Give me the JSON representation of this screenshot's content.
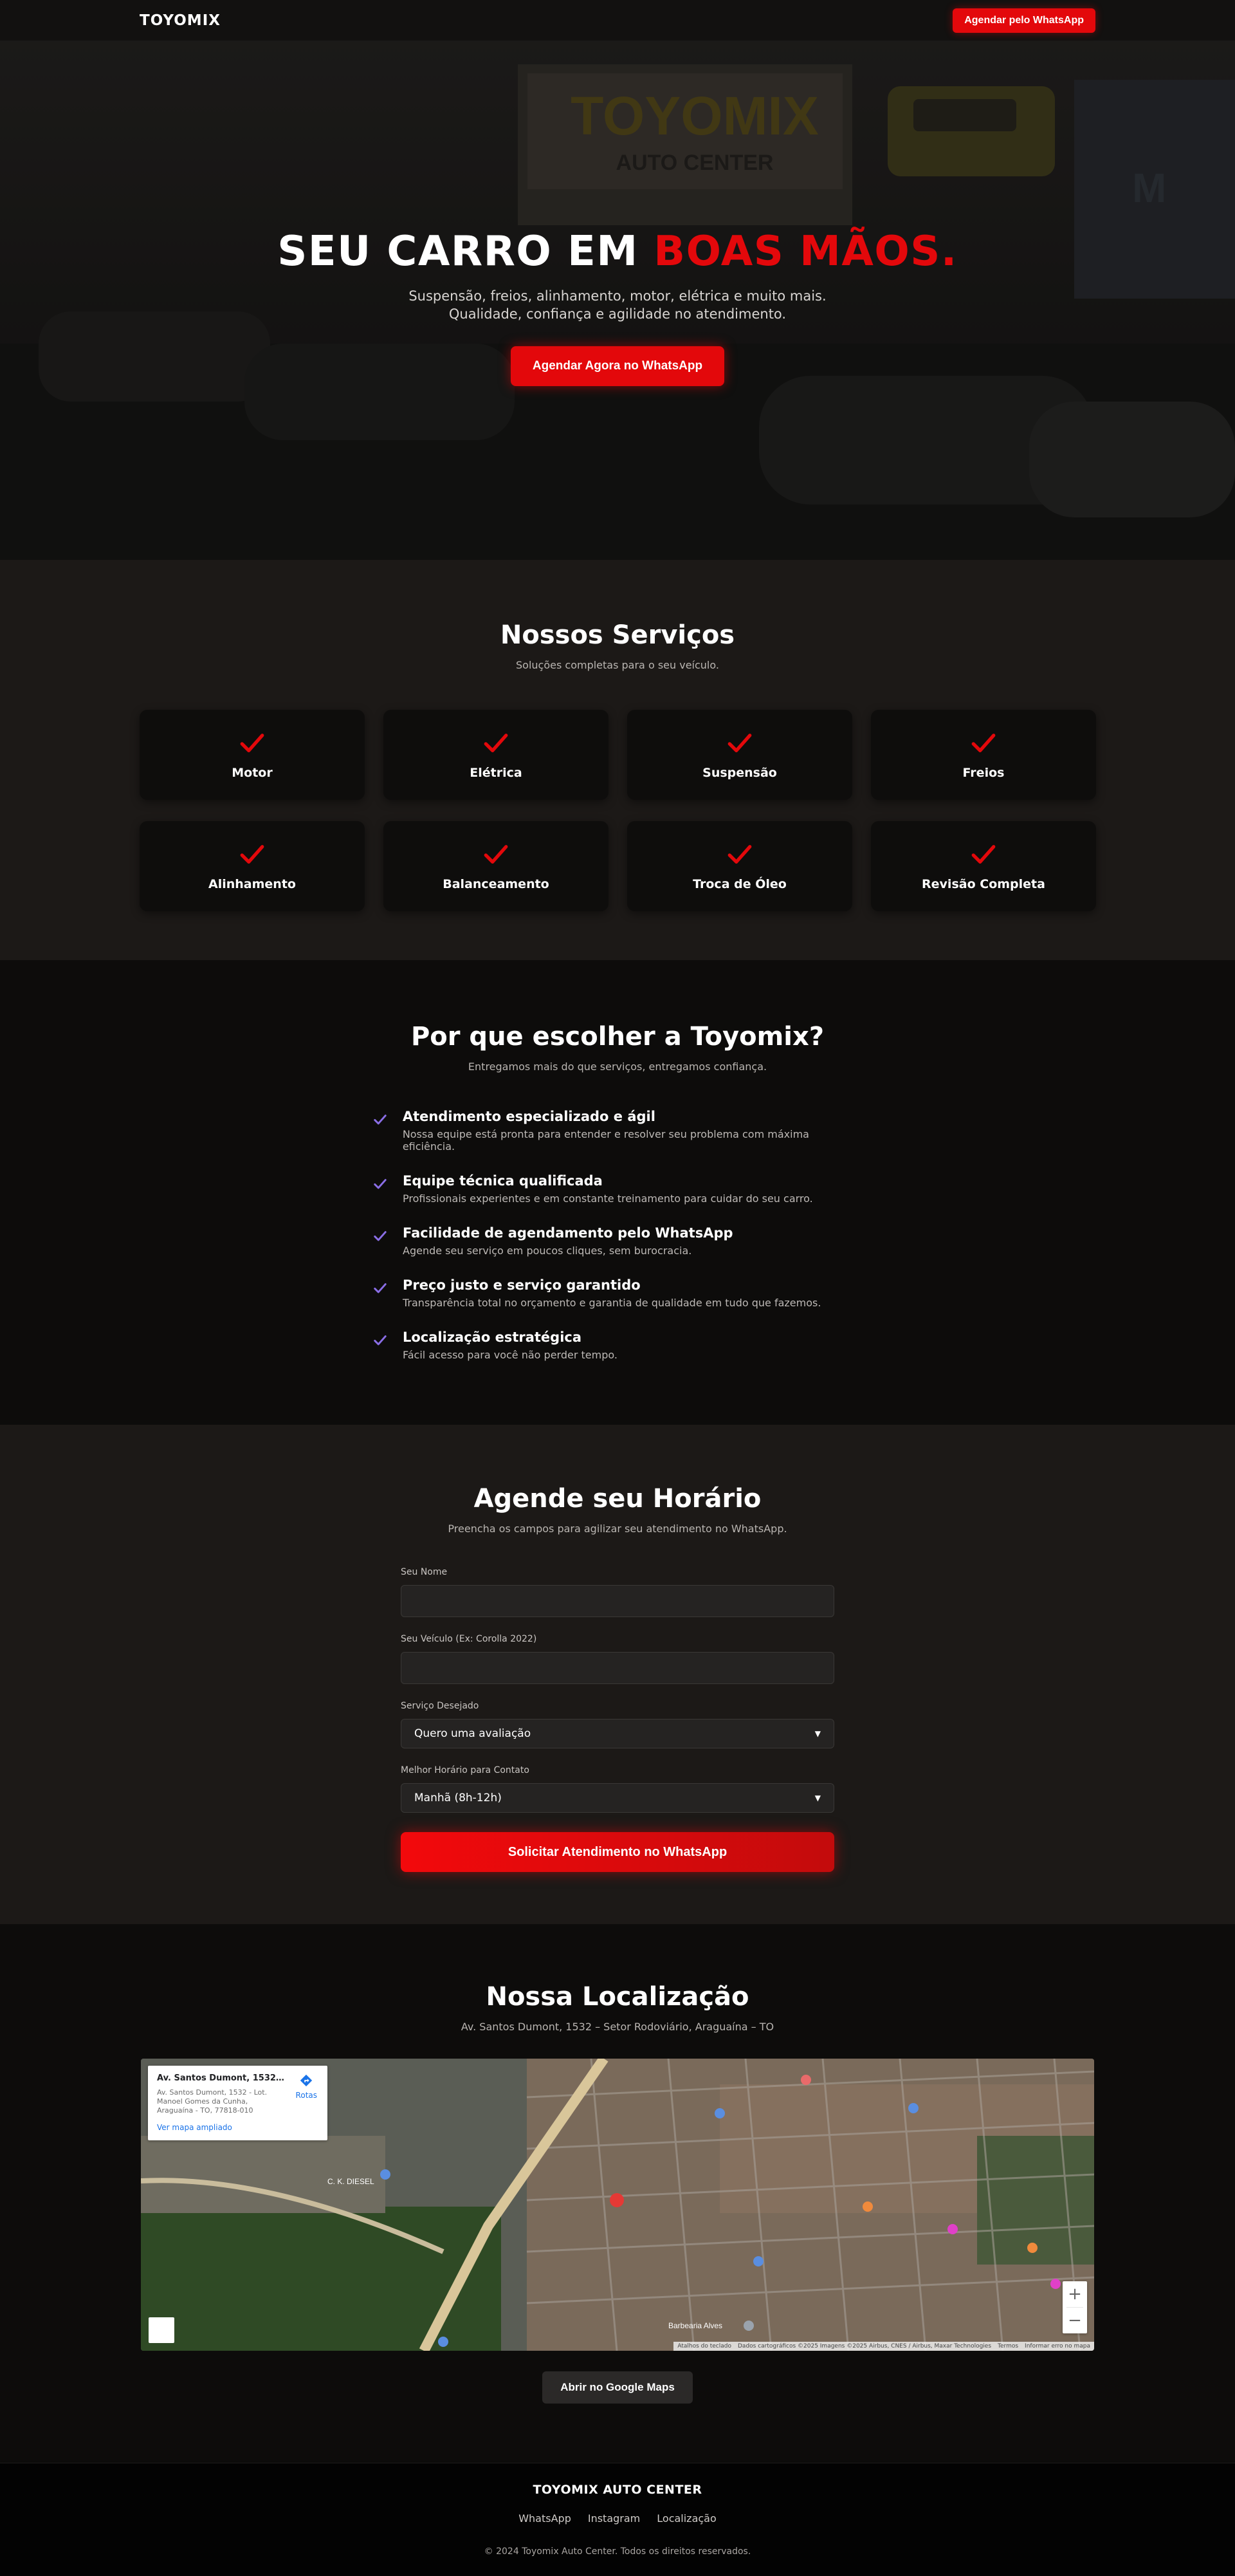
{
  "colors": {
    "accent": "#e3080b",
    "check_purple": "#8a6ee6",
    "background": "#0d0c0b",
    "section_alt": "#1c1917"
  },
  "nav": {
    "logo": "TOYOMIX",
    "cta": "Agendar pelo WhatsApp"
  },
  "hero": {
    "title_main": "SEU CARRO EM",
    "title_accent": "BOAS MÃOS.",
    "subtitle": "Suspensão, freios, alinhamento, motor, elétrica e muito mais. Qualidade, confiança e agilidade no atendimento.",
    "cta": "Agendar Agora no WhatsApp",
    "bg_sign_1": "TOYOMIX",
    "bg_sign_2": "AUTO CENTER"
  },
  "services": {
    "title": "Nossos Serviços",
    "subtitle": "Soluções completas para o seu veículo.",
    "items": [
      {
        "label": "Motor",
        "icon": "check-icon"
      },
      {
        "label": "Elétrica",
        "icon": "check-icon"
      },
      {
        "label": "Suspensão",
        "icon": "check-icon"
      },
      {
        "label": "Freios",
        "icon": "check-icon"
      },
      {
        "label": "Alinhamento",
        "icon": "check-icon"
      },
      {
        "label": "Balanceamento",
        "icon": "check-icon"
      },
      {
        "label": "Troca de Óleo",
        "icon": "check-icon"
      },
      {
        "label": "Revisão Completa",
        "icon": "check-icon"
      }
    ]
  },
  "why": {
    "title": "Por que escolher a Toyomix?",
    "subtitle": "Entregamos mais do que serviços, entregamos confiança.",
    "items": [
      {
        "title": "Atendimento especializado e ágil",
        "desc": "Nossa equipe está pronta para entender e resolver seu problema com máxima eficiência."
      },
      {
        "title": "Equipe técnica qualificada",
        "desc": "Profissionais experientes e em constante treinamento para cuidar do seu carro."
      },
      {
        "title": "Facilidade de agendamento pelo WhatsApp",
        "desc": "Agende seu serviço em poucos cliques, sem burocracia."
      },
      {
        "title": "Preço justo e serviço garantido",
        "desc": "Transparência total no orçamento e garantia de qualidade em tudo que fazemos."
      },
      {
        "title": "Localização estratégica",
        "desc": "Fácil acesso para você não perder tempo."
      }
    ]
  },
  "form": {
    "title": "Agende seu Horário",
    "subtitle": "Preencha os campos para agilizar seu atendimento no WhatsApp.",
    "name_label": "Seu Nome",
    "name_value": "",
    "vehicle_label": "Seu Veículo (Ex: Corolla 2022)",
    "vehicle_value": "",
    "service_label": "Serviço Desejado",
    "service_value": "Quero uma avaliação",
    "time_label": "Melhor Horário para Contato",
    "time_value": "Manhã (8h-12h)",
    "submit": "Solicitar Atendimento no WhatsApp"
  },
  "location": {
    "title": "Nossa Localização",
    "address": "Av. Santos Dumont, 1532 – Setor Rodoviário, Araguaína – TO",
    "map_card_title": "Av. Santos Dumont, 1532 - Lot...",
    "map_card_address": "Av. Santos Dumont, 1532 - Lot. Manoel Gomes da Cunha, Araguaína - TO, 77818-010",
    "map_card_directions": "Rotas",
    "map_card_larger": "Ver mapa ampliado",
    "zoom_in": "+",
    "zoom_out": "−",
    "attribution": [
      "Atalhos do teclado",
      "Dados cartográficos ©2025 Imagens ©2025 Airbus, CNES / Airbus, Maxar Technologies",
      "Termos",
      "Informar erro no mapa"
    ],
    "map_labels": [
      "C. K. DIESEL",
      "Barbearia Alves"
    ],
    "open_maps": "Abrir no Google Maps"
  },
  "footer": {
    "brand": "TOYOMIX AUTO CENTER",
    "links": [
      "WhatsApp",
      "Instagram",
      "Localização"
    ],
    "copyright": "© 2024 Toyomix Auto Center. Todos os direitos reservados."
  }
}
